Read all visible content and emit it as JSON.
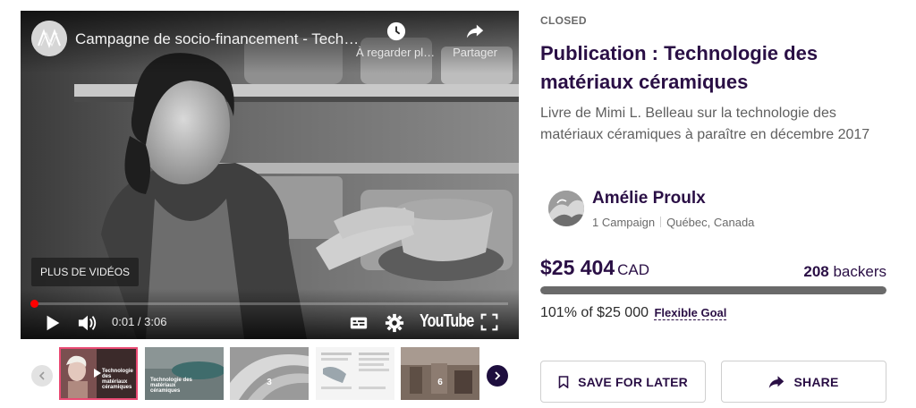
{
  "video": {
    "title": "Campagne de socio-financement - Technologie des matériaux céramiques",
    "watch_later_label": "À regarder plus tard",
    "share_label": "Partager",
    "more_videos_label": "PLUS DE VIDÉOS",
    "time": "0:01 / 3:06",
    "progress_fraction": 0.005,
    "logo_text": "YouTube"
  },
  "thumbnails": [
    {
      "caption": "Technologie des matériaux céramiques",
      "active": true
    },
    {
      "caption": "Technologie des matériaux céramiques"
    },
    {
      "number": "3"
    },
    {
      "number": ""
    },
    {
      "number": "6"
    }
  ],
  "campaign": {
    "status": "CLOSED",
    "title": "Publication : Technologie des matériaux céramiques",
    "description": "Livre de Mimi L. Belleau sur la technologie des matériaux céramiques à paraître en décembre 2017"
  },
  "owner": {
    "name": "Amélie Proulx",
    "campaigns": "1 Campaign",
    "location": "Québec, Canada"
  },
  "funding": {
    "amount": "$25 404",
    "currency": "CAD",
    "backers_count": "208",
    "backers_label": "backers",
    "percent_of_goal": "101% of $25 000",
    "goal_type": "Flexible Goal",
    "progress_fraction": 1.0
  },
  "actions": {
    "save_label": "SAVE FOR LATER",
    "share_label": "SHARE"
  },
  "colors": {
    "brand_dark": "#2a0f45",
    "progress_red": "#ff0000",
    "active_thumb_border": "#e94a73"
  },
  "icons": [
    "clock-icon",
    "share-arrow-icon",
    "play-icon",
    "volume-icon",
    "subtitles-icon",
    "settings-gear-icon",
    "fullscreen-icon",
    "chevron-left-icon",
    "chevron-right-icon",
    "bookmark-icon"
  ]
}
